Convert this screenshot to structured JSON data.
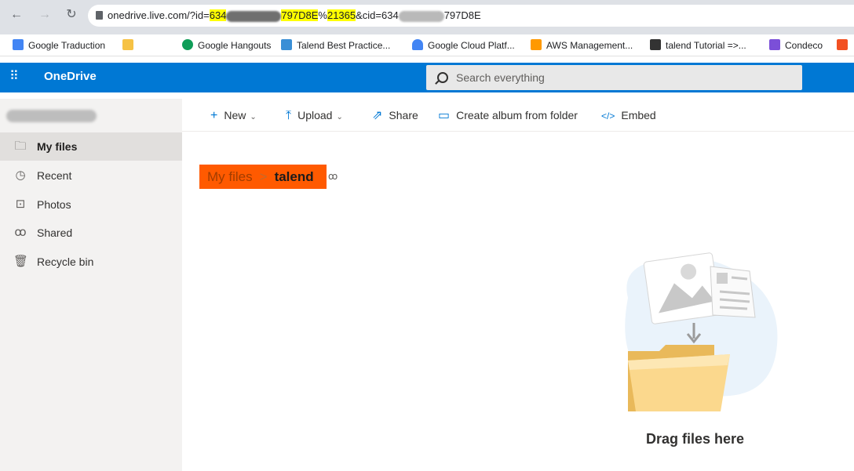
{
  "browser": {
    "address": {
      "part1": "onedrive.live.com/?id=",
      "hl1": "634",
      "hl2": "797D8E",
      "part2": "%",
      "hl3": "21365",
      "part3": "&cid=634",
      "part4": "797D8E"
    },
    "bookmarks": [
      {
        "label": "Google Traduction",
        "color": "#4285f4"
      },
      {
        "label": "",
        "color": "#f6c244"
      },
      {
        "label": "Google Hangouts",
        "color": "#0f9d58"
      },
      {
        "label": "Talend Best Practice...",
        "color": "#3a8fd6"
      },
      {
        "label": "Google Cloud Platf...",
        "color": "#4285f4"
      },
      {
        "label": "AWS Management...",
        "color": "#ff9900"
      },
      {
        "label": "talend Tutorial =>...",
        "color": "#333333"
      },
      {
        "label": "Condeco",
        "color": "#7b4fd8"
      }
    ]
  },
  "app": {
    "brand": "OneDrive",
    "search_placeholder": "Search everything",
    "accent": "#0078d4"
  },
  "sidebar": {
    "items": [
      {
        "label": "My files",
        "icon": "folder-icon"
      },
      {
        "label": "Recent",
        "icon": "clock-icon"
      },
      {
        "label": "Photos",
        "icon": "photo-icon"
      },
      {
        "label": "Shared",
        "icon": "people-icon"
      },
      {
        "label": "Recycle bin",
        "icon": "trash-icon"
      }
    ]
  },
  "commands": {
    "new": "New",
    "upload": "Upload",
    "share": "Share",
    "album": "Create album from folder",
    "embed": "Embed"
  },
  "breadcrumb": {
    "root": "My files",
    "current": "talend"
  },
  "empty_state": {
    "text": "Drag files here"
  }
}
